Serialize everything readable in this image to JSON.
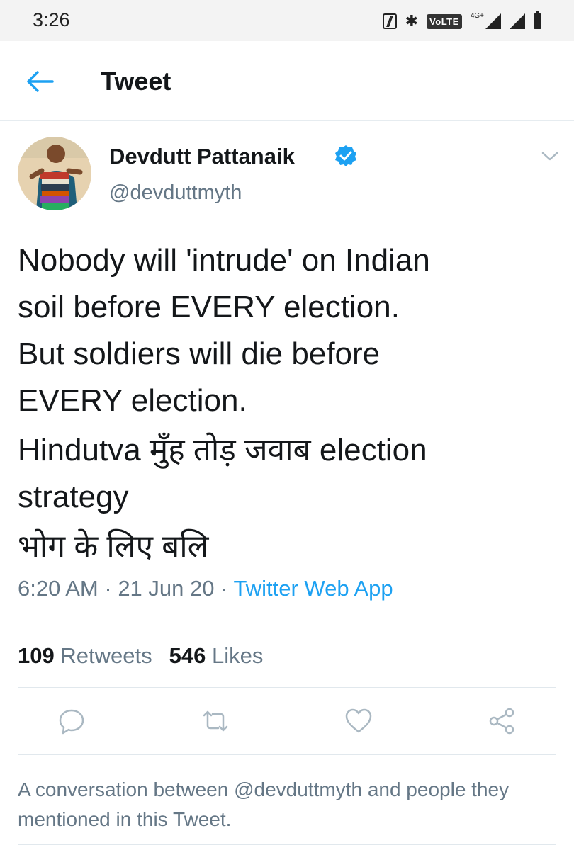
{
  "status_bar": {
    "time": "3:26",
    "volte": "VoLTE",
    "network": "4G+"
  },
  "header": {
    "title": "Tweet"
  },
  "author": {
    "name": "Devdutt Pattanaik",
    "handle": "@devduttmyth",
    "verified": true
  },
  "tweet": {
    "lines": [
      "Nobody will 'intrude' on Indian",
      "soil before EVERY election.",
      "But soldiers will die before",
      "EVERY election.",
      "Hindutva  मुँह तोड़ जवाब election",
      "strategy",
      " भोग के लिए बलि"
    ],
    "time": "6:20 AM",
    "date": "21 Jun 20",
    "separator": " · ",
    "source": "Twitter Web App"
  },
  "stats": {
    "retweets_count": "109",
    "retweets_label": "Retweets",
    "likes_count": "546",
    "likes_label": "Likes"
  },
  "actions": {
    "reply": "reply-icon",
    "retweet": "retweet-icon",
    "like": "heart-icon",
    "share": "share-icon"
  },
  "footer": {
    "text": "A conversation between @devduttmyth and people they mentioned in this Tweet."
  },
  "colors": {
    "accent": "#1da1f2",
    "secondary_text": "#657786",
    "primary_text": "#14171a",
    "status_bar_bg": "#f3f3f3"
  }
}
